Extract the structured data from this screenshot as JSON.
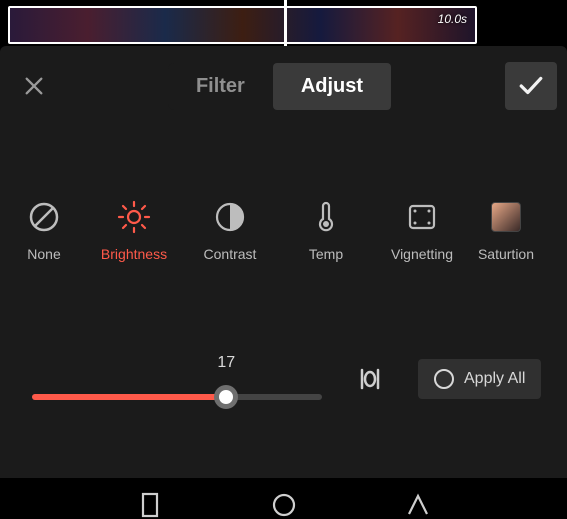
{
  "accent": "#ff5a4a",
  "timeline": {
    "clip_duration": "10.0s"
  },
  "topbar": {
    "tabs": {
      "filter": "Filter",
      "adjust": "Adjust"
    },
    "active_tab": "adjust"
  },
  "tools": {
    "items": [
      {
        "key": "none",
        "label": "None",
        "icon": "ban-icon",
        "active": false
      },
      {
        "key": "brightness",
        "label": "Brightness",
        "icon": "brightness-icon",
        "active": true
      },
      {
        "key": "contrast",
        "label": "Contrast",
        "icon": "contrast-icon",
        "active": false
      },
      {
        "key": "temp",
        "label": "Temp",
        "icon": "temp-icon",
        "active": false
      },
      {
        "key": "vignetting",
        "label": "Vignetting",
        "icon": "vignette-icon",
        "active": false
      },
      {
        "key": "saturation",
        "label": "Saturtion",
        "icon": "saturation-icon",
        "active": false
      }
    ]
  },
  "slider": {
    "value": 17,
    "min": -50,
    "max": 50
  },
  "apply_all_label": "Apply All"
}
